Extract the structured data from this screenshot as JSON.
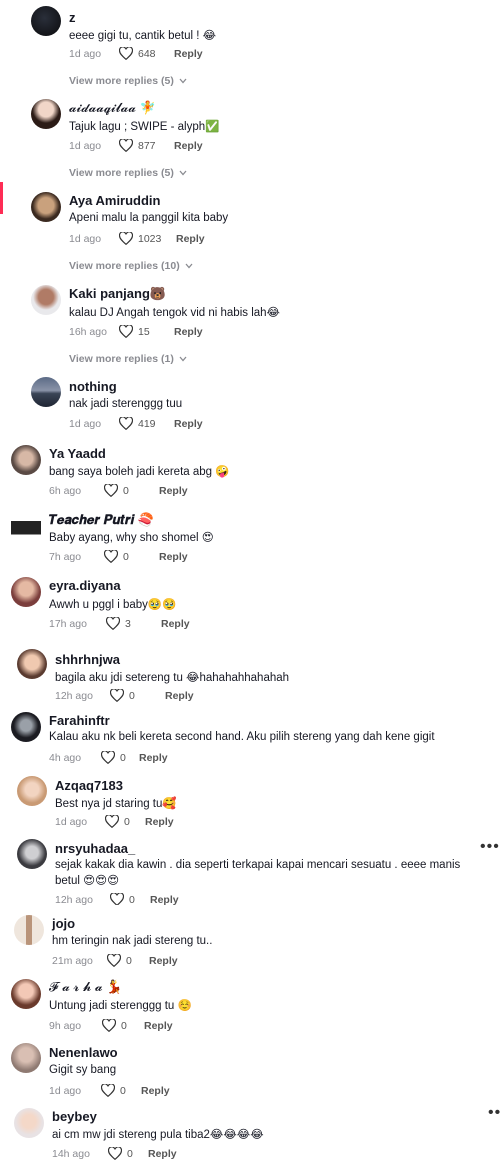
{
  "comments": [
    {
      "name": "z",
      "text": "eeee gigi tu, cantik betul ! 😂",
      "time": "1d ago",
      "likes": "648",
      "reply": "Reply",
      "view_more": "View more replies (5)"
    },
    {
      "name": "𝓪𝓲𝓭𝓪𝓪𝓺𝓲𝓵𝓪𝓪 🧚",
      "text": "Tajuk lagu ; SWIPE - alyph✅",
      "time": "1d ago",
      "likes": "877",
      "reply": "Reply",
      "view_more": "View more replies (5)"
    },
    {
      "name": "Aya Amiruddin",
      "text": "Apeni malu la panggil kita baby",
      "time": "1d ago",
      "likes": "1023",
      "reply": "Reply",
      "view_more": "View more replies (10)"
    },
    {
      "name": "Kaki panjang🐻",
      "text": "kalau DJ Angah tengok vid ni habis lah😂",
      "time": "16h ago",
      "likes": "15",
      "reply": "Reply",
      "view_more": "View more replies (1)"
    },
    {
      "name": "nothing",
      "text": "nak jadi sterenggg tuu",
      "time": "1d ago",
      "likes": "419",
      "reply": "Reply"
    },
    {
      "name": "Ya Yaadd",
      "text": "bang saya boleh jadi kereta abg 🤪",
      "time": "6h ago",
      "likes": "0",
      "reply": "Reply"
    },
    {
      "name": "𝑻𝒆𝒂𝒄𝒉𝒆𝒓 𝑷𝒖𝒕𝒓𝒊 🍣",
      "text": "Baby ayang, why sho shomel 😍",
      "time": "7h ago",
      "likes": "0",
      "reply": "Reply"
    },
    {
      "name": "eyra.diyana",
      "text": "Awwh u pggl i baby🥹🥹",
      "time": "17h ago",
      "likes": "3",
      "reply": "Reply"
    },
    {
      "name": "shhrhnjwa",
      "text": "bagila aku jdi setereng tu 😂hahahahhahahah",
      "time": "12h ago",
      "likes": "0",
      "reply": "Reply"
    },
    {
      "name": "Farahinftr",
      "text": "Kalau aku nk beli kereta second hand. Aku pilih stereng yang dah kene gigit",
      "time": "4h ago",
      "likes": "0",
      "reply": "Reply"
    },
    {
      "name": "Azqaq7183",
      "text": "Best nya jd staring tu🥰",
      "time": "1d ago",
      "likes": "0",
      "reply": "Reply"
    },
    {
      "name": "nrsyuhadaa_",
      "text": "sejak kakak dia kawin . dia seperti terkapai kapai mencari sesuatu . eeee manis betul 😍😍😍",
      "time": "12h ago",
      "likes": "0",
      "reply": "Reply"
    },
    {
      "name": "jojo",
      "text": "hm teringin nak jadi stereng tu..",
      "time": "21m ago",
      "likes": "0",
      "reply": "Reply"
    },
    {
      "name": "𝓕 𝓪 𝓻 𝓱 𝓪 💃",
      "text": "Untung jadi sterenggg tu ☺️",
      "time": "9h ago",
      "likes": "0",
      "reply": "Reply"
    },
    {
      "name": "Nenenlawo",
      "text": "Gigit sy bang",
      "time": "1d ago",
      "likes": "0",
      "reply": "Reply"
    },
    {
      "name": "beybey",
      "text": "ai cm mw jdi stereng pula tiba2😂😂😂😂",
      "time": "14h ago",
      "likes": "0",
      "reply": "Reply"
    }
  ],
  "more_label": "•••",
  "colors": {
    "text": "#161823",
    "muted": "#8a8b91",
    "accent": "#fe2c55"
  }
}
